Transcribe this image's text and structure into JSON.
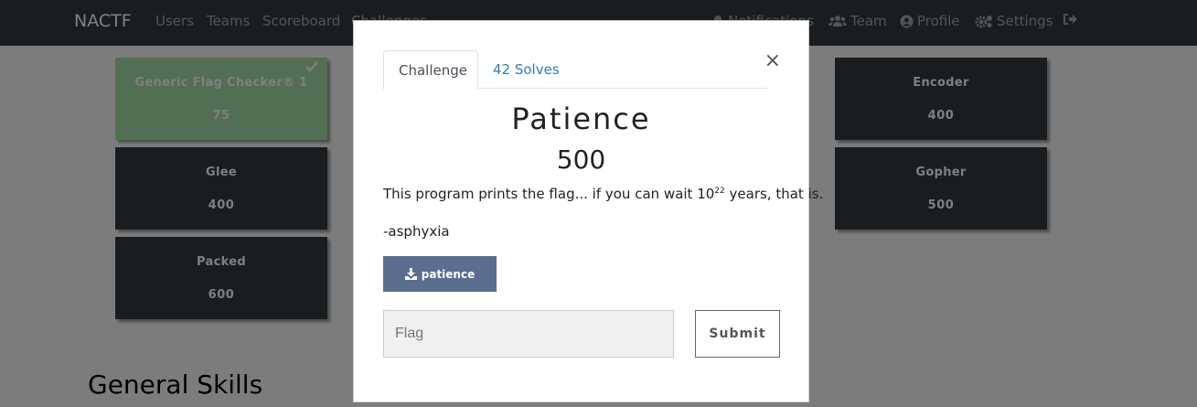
{
  "navbar": {
    "brand": "NACTF",
    "links": [
      "Users",
      "Teams",
      "Scoreboard",
      "Challenges"
    ],
    "right": [
      "Notifications",
      "Team",
      "Profile",
      "Settings"
    ]
  },
  "tiles": [
    {
      "name": "Generic Flag Checker® 1",
      "value": "75",
      "solved": true
    },
    {
      "name": "Glee",
      "value": "400",
      "solved": false
    },
    {
      "name": "Packed",
      "value": "600",
      "solved": false
    },
    {
      "name": "Encoder",
      "value": "400",
      "solved": false
    },
    {
      "name": "Gopher",
      "value": "500",
      "solved": false
    }
  ],
  "section_title": "General Skills",
  "modal": {
    "tab_challenge": "Challenge",
    "tab_solves": "42 Solves",
    "close": "×",
    "name": "Patience",
    "value": "500",
    "description_before": "This program prints the flag... if you can wait 10",
    "description_exp": "22",
    "description_after": " years, that is.",
    "author": "-asphyxia",
    "file": "patience",
    "flag_placeholder": "Flag",
    "submit": "Submit"
  },
  "colors": {
    "navbar": "#343a40",
    "tile": "#343a40",
    "solved_tile": "#a6dfa6",
    "file_button": "#5b6e8f",
    "link": "#337ab7"
  }
}
